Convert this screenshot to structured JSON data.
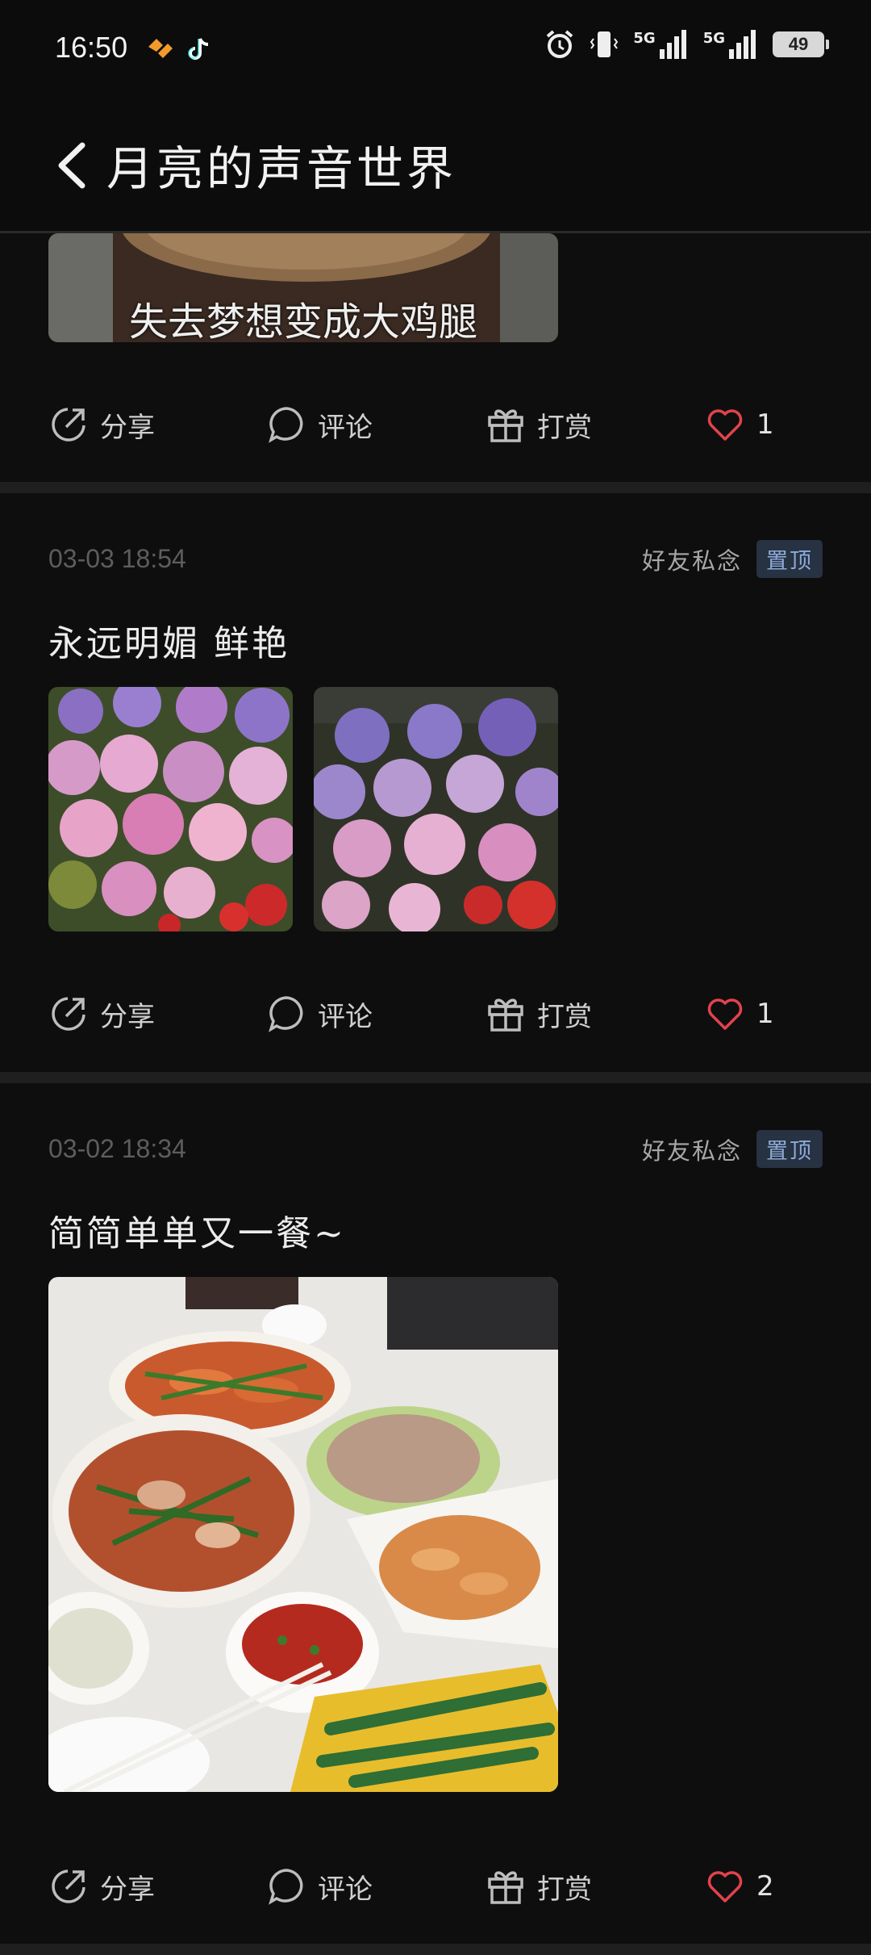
{
  "status_bar": {
    "time": "16:50",
    "battery": "49",
    "network_1": "5G",
    "network_2": "5G"
  },
  "header": {
    "title": "月亮的声音世界"
  },
  "actions_labels": {
    "share": "分享",
    "comment": "评论",
    "reward": "打赏"
  },
  "posts": [
    {
      "caption_overlay": "失去梦想变成大鸡腿",
      "likes": "1"
    },
    {
      "date": "03-03 18:54",
      "privacy": "好友私念",
      "pin": "置顶",
      "title": "永远明媚 鲜艳",
      "likes": "1"
    },
    {
      "date": "03-02 18:34",
      "privacy": "好友私念",
      "pin": "置顶",
      "title": "简简单单又一餐~",
      "likes": "2"
    }
  ],
  "colors": {
    "background": "#0e0e0f",
    "heart": "#e2434b",
    "pin_text": "#8eaad8",
    "pin_bg": "#273242"
  }
}
